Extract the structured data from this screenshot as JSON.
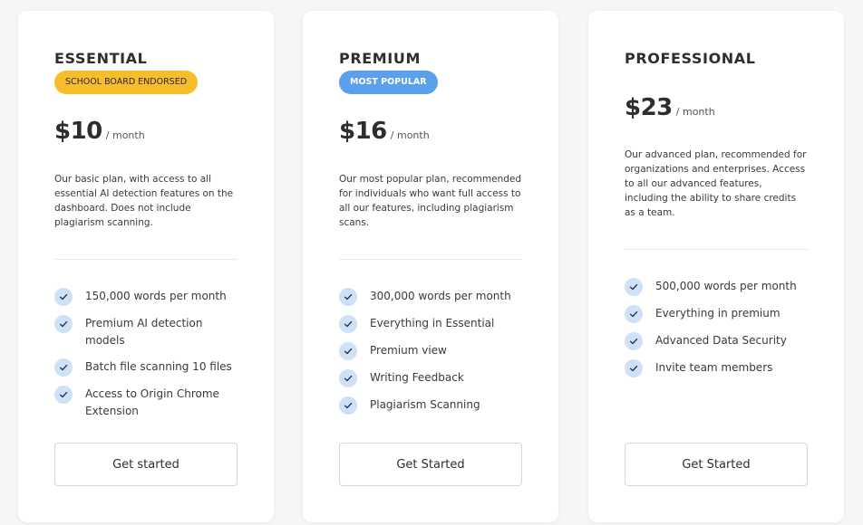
{
  "plans": [
    {
      "name": "ESSENTIAL",
      "badge": "SCHOOL BOARD ENDORSED",
      "badge_color": "#f7bd2a",
      "price": "$10",
      "period": "/ month",
      "description": "Our basic plan, with access to all essential AI detection features on the dashboard. Does not include plagiarism scanning.",
      "features": [
        "150,000 words per month",
        "Premium AI detection models",
        "Batch file scanning 10 files",
        "Access to Origin Chrome Extension"
      ],
      "cta": "Get started"
    },
    {
      "name": "PREMIUM",
      "badge": "MOST POPULAR",
      "badge_color": "#5ba0ec",
      "price": "$16",
      "period": "/ month",
      "description": "Our most popular plan, recommended for individuals who want full access to all our features, including plagiarism scans.",
      "features": [
        "300,000 words per month",
        "Everything in Essential",
        "Premium view",
        "Writing Feedback",
        "Plagiarism Scanning"
      ],
      "cta": "Get Started"
    },
    {
      "name": "PROFESSIONAL",
      "price": "$23",
      "period": "/ month",
      "description": "Our advanced plan, recommended for organizations and enterprises. Access to all our advanced features, including the ability to share credits as a team.",
      "features": [
        "500,000 words per month",
        "Everything in premium",
        "Advanced Data Security",
        "Invite team members"
      ],
      "cta": "Get Started"
    }
  ],
  "icons": {
    "feature_check": "check-icon"
  },
  "colors": {
    "page_background": "#f7f6f4",
    "card_background": "#ffffff",
    "check_circle": "#cfe1f7"
  }
}
